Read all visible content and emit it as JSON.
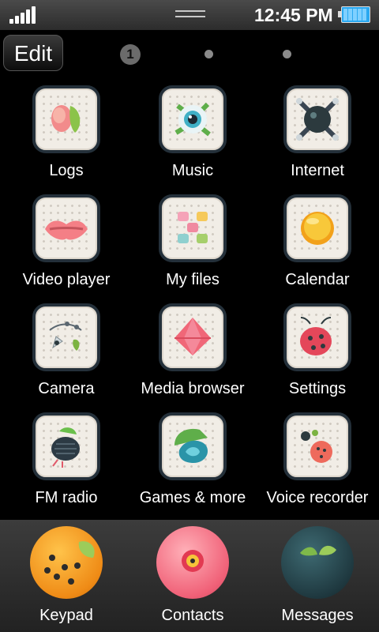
{
  "status_bar": {
    "time": "12:45 PM"
  },
  "top_bar": {
    "edit_label": "Edit",
    "current_page": "1"
  },
  "apps": [
    {
      "label": "Logs"
    },
    {
      "label": "Music"
    },
    {
      "label": "Internet"
    },
    {
      "label": "Video player"
    },
    {
      "label": "My files"
    },
    {
      "label": "Calendar"
    },
    {
      "label": "Camera"
    },
    {
      "label": "Media browser"
    },
    {
      "label": "Settings"
    },
    {
      "label": "FM radio"
    },
    {
      "label": "Games & more"
    },
    {
      "label": "Voice recorder"
    }
  ],
  "dock": [
    {
      "label": "Keypad"
    },
    {
      "label": "Contacts"
    },
    {
      "label": "Messages"
    }
  ]
}
